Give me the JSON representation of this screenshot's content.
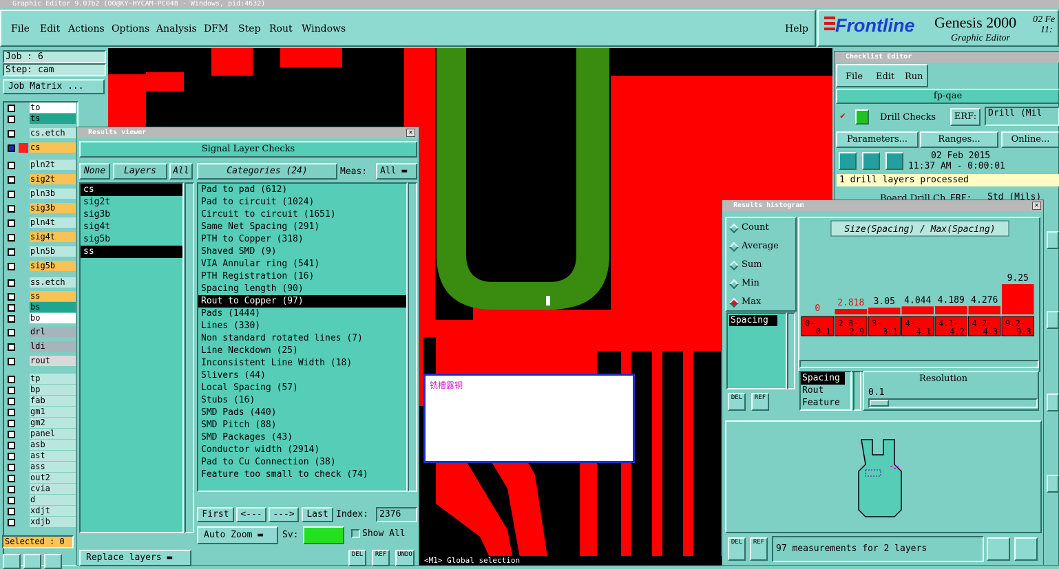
{
  "app": {
    "title": "Graphic Editor 9.07b2 (OO@KY-HYCAM-PC048 - Windows, pid:4632)"
  },
  "menu": {
    "items": [
      "File",
      "Edit",
      "Actions",
      "Options",
      "Analysis",
      "DFM",
      "Step",
      "Rout",
      "Windows"
    ],
    "help": "Help"
  },
  "brand": {
    "logo": "Frontline",
    "product": "Genesis 2000",
    "subtitle": "Graphic Editor",
    "date": "02 Fe",
    "time": "11:"
  },
  "job": {
    "job_label": "Job : 6",
    "step_label": "Step: cam",
    "matrix_button": "Job Matrix ..."
  },
  "layers": [
    {
      "name": "to",
      "color": "#ffffff"
    },
    {
      "name": "ts",
      "color": "#21a58e"
    },
    {
      "name": "cs.etch",
      "color": "#b9e6de"
    },
    {
      "name": "cs",
      "color": "#f9c254"
    },
    {
      "name": "pln2t",
      "color": "#b9e6de"
    },
    {
      "name": "sig2t",
      "color": "#f9c254"
    },
    {
      "name": "pln3b",
      "color": "#b9e6de"
    },
    {
      "name": "sig3b",
      "color": "#f9c254"
    },
    {
      "name": "pln4t",
      "color": "#b9e6de"
    },
    {
      "name": "sig4t",
      "color": "#f9c254"
    },
    {
      "name": "pln5b",
      "color": "#b9e6de"
    },
    {
      "name": "sig5b",
      "color": "#f9c254"
    },
    {
      "name": "ss.etch",
      "color": "#b9e6de"
    },
    {
      "name": "ss",
      "color": "#f9c254"
    },
    {
      "name": "bs",
      "color": "#21a58e"
    },
    {
      "name": "bo",
      "color": "#ffffff"
    },
    {
      "name": "drl",
      "color": "#a7b4bc"
    },
    {
      "name": "ldi",
      "color": "#a7b4bc"
    },
    {
      "name": "rout",
      "color": "#d9d9d9"
    },
    {
      "name": "tp",
      "color": "#b9e6de"
    },
    {
      "name": "bp",
      "color": "#b9e6de"
    },
    {
      "name": "fab",
      "color": "#b9e6de"
    },
    {
      "name": "gm1",
      "color": "#b9e6de"
    },
    {
      "name": "gm2",
      "color": "#b9e6de"
    },
    {
      "name": "panel",
      "color": "#b9e6de"
    },
    {
      "name": "asb",
      "color": "#b9e6de"
    },
    {
      "name": "ast",
      "color": "#b9e6de"
    },
    {
      "name": "ass",
      "color": "#b9e6de"
    },
    {
      "name": "out2",
      "color": "#b9e6de"
    },
    {
      "name": "cvia",
      "color": "#b9e6de"
    },
    {
      "name": "d",
      "color": "#b9e6de"
    },
    {
      "name": "xdjt",
      "color": "#b9e6de"
    },
    {
      "name": "xdjb",
      "color": "#b9e6de"
    }
  ],
  "selected": "Selected : 0",
  "results_viewer": {
    "title": "Results viewer",
    "header": "Signal Layer Checks",
    "none": "None",
    "layers_label": "Layers",
    "all": "All",
    "layers": [
      "cs",
      "sig2t",
      "sig3b",
      "sig4t",
      "sig5b",
      "ss"
    ],
    "categories_label": "Categories (24)",
    "meas_label": "Meas:",
    "meas_value": "All",
    "categories": [
      "Pad to pad (612)",
      "Pad to circuit (1024)",
      "Circuit to circuit (1651)",
      "Same Net Spacing (291)",
      "PTH to Copper (318)",
      "Shaved SMD (9)",
      "VIA Annular ring (541)",
      "PTH Registration (16)",
      "Spacing length (90)",
      "Rout to Copper (97)",
      "Pads (1444)",
      "Lines (330)",
      "Non standard rotated lines (7)",
      "Line Neckdown (25)",
      "Inconsistent Line Width (18)",
      "Slivers (44)",
      "Local Spacing (57)",
      "Stubs (16)",
      "SMD Pads (440)",
      "SMD Pitch (88)",
      "SMD Packages (43)",
      "Conductor width (2914)",
      "Pad to Cu Connection (38)",
      "Feature too small to check (74)"
    ],
    "first": "First",
    "prev": "<---",
    "next": "--->",
    "last": "Last",
    "index_label": "Index:",
    "index_value": "2376",
    "auto_zoom": "Auto Zoom",
    "sv": "Sv:",
    "show_all": "Show All",
    "replace_layers": "Replace layers",
    "del": "DEL",
    "ref": "REF",
    "undo": "UNDO"
  },
  "popup": {
    "text": "铣槽露铜"
  },
  "status": {
    "text": "<M1> Global selection"
  },
  "checklist": {
    "title": "Checklist Editor",
    "menu": [
      "File",
      "Edit",
      "Run"
    ],
    "name": "fp-qae",
    "check1": "Drill Checks",
    "erf": "ERF:",
    "erf_value": "Drill (Mil",
    "parameters": "Parameters...",
    "ranges": "Ranges...",
    "online": "Online...",
    "date": "02 Feb 2015",
    "time": "11:37 AM - 0:00:01",
    "processed": "1 drill layers processed",
    "check2": "Board Drill Ch",
    "erf2": "ERF:",
    "erf_value2": "Std (Mils)"
  },
  "histogram": {
    "title": "Results histogram",
    "options": [
      "Count",
      "Average",
      "Sum",
      "Min",
      "Max"
    ],
    "selected_option": "Max",
    "list_item": "Spacing",
    "chart_title": "Size(Spacing) / Max(Spacing)",
    "bin_list": [
      "Spacing",
      "Rout",
      "Feature"
    ],
    "resolution_label": "Resolution",
    "resolution_value": "0.1",
    "footer": "97 measurements for 2 layers",
    "del": "DEL",
    "ref": "REF"
  },
  "chart_data": {
    "type": "bar",
    "title": "Size(Spacing) / Max(Spacing)",
    "categories": [
      "0-0.1",
      "2.8-2.9",
      "3-3.1",
      "4-4.1",
      "4.1-4.2",
      "4.2-4.3",
      "9.2-9.3"
    ],
    "values": [
      0,
      2.818,
      3.05,
      4.044,
      4.189,
      4.276,
      9.25
    ],
    "labels": [
      "0",
      "2.818",
      "3.05",
      "4.044",
      "4.189",
      "4.276",
      "9.25"
    ],
    "tick_labels": [
      [
        "0-",
        "0.1"
      ],
      [
        "2.8-",
        "2.9"
      ],
      [
        "3-",
        "3.1"
      ],
      [
        "4-",
        "4.1"
      ],
      [
        "4.1-",
        "4.2"
      ],
      [
        "4.2-",
        "4.3"
      ],
      [
        "9.2-",
        "9.3"
      ]
    ],
    "ylim": [
      0,
      9.25
    ]
  },
  "colors": {
    "bg": "#7ecfc4",
    "panel": "#55cdb7",
    "red": "#ff0000",
    "green": "#3a8c10",
    "accent_blue": "#1d3fd0"
  }
}
